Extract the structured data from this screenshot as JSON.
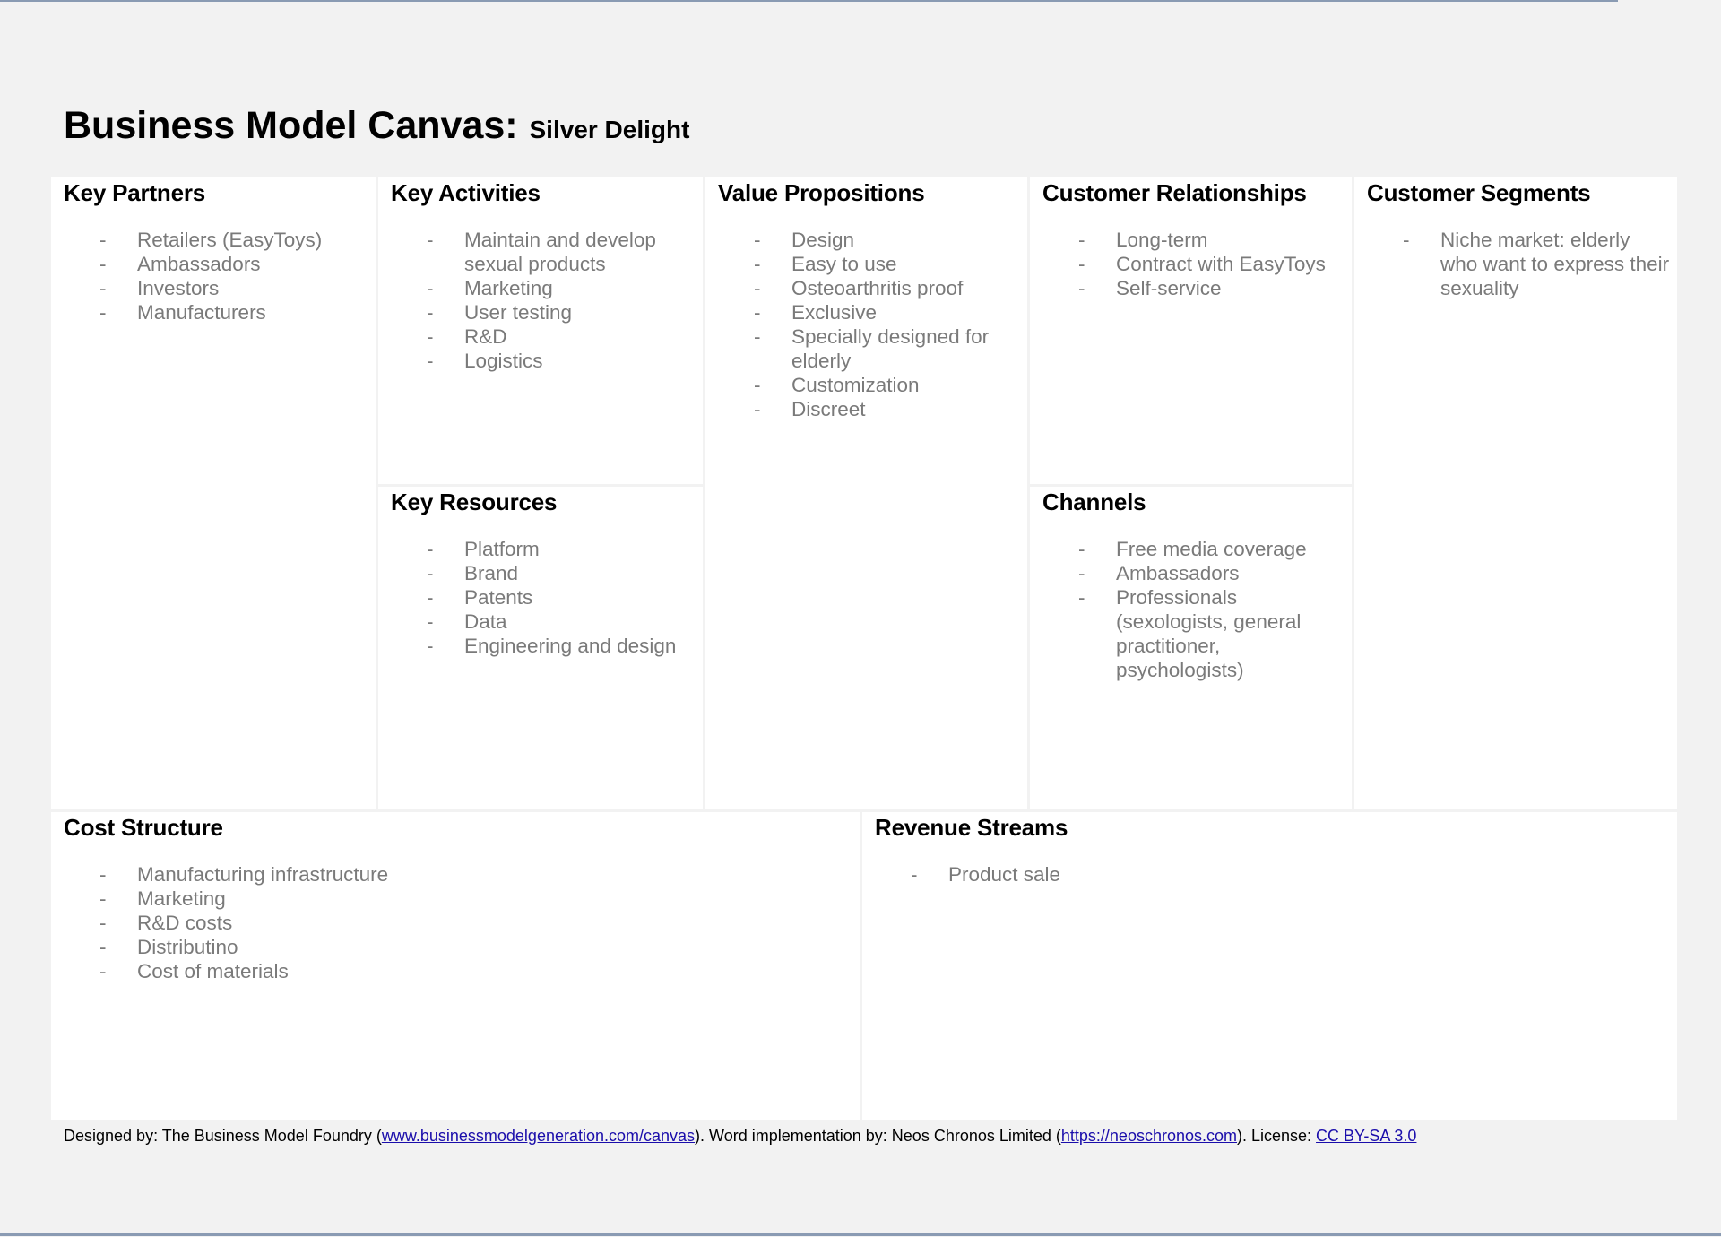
{
  "title": {
    "main": "Business Model Canvas:",
    "sub": "Silver Delight"
  },
  "canvas": {
    "key_partners": {
      "heading": "Key Partners",
      "items": [
        "Retailers (EasyToys)",
        "Ambassadors",
        "Investors",
        "Manufacturers"
      ]
    },
    "key_activities": {
      "heading": "Key Activities",
      "items": [
        "Maintain and develop sexual products",
        "Marketing",
        "User testing",
        "R&D",
        "Logistics"
      ]
    },
    "key_resources": {
      "heading": "Key Resources",
      "items": [
        "Platform",
        "Brand",
        "Patents",
        "Data",
        "Engineering and design"
      ]
    },
    "value_propositions": {
      "heading": "Value Propositions",
      "items": [
        "Design",
        "Easy to use",
        "Osteoarthritis proof",
        "Exclusive",
        "Specially designed for elderly",
        "Customization",
        "Discreet"
      ]
    },
    "customer_relationships": {
      "heading": "Customer Relationships",
      "items": [
        "Long-term",
        "Contract with EasyToys",
        "Self-service"
      ]
    },
    "channels": {
      "heading": "Channels",
      "items": [
        "Free media coverage",
        "Ambassadors",
        "Professionals (sexologists, general practitioner, psychologists)"
      ]
    },
    "customer_segments": {
      "heading": "Customer Segments",
      "items": [
        "Niche market: elderly who want to express their sexuality"
      ]
    },
    "cost_structure": {
      "heading": "Cost Structure",
      "items": [
        "Manufacturing infrastructure",
        "Marketing",
        "R&D costs",
        "Distributino",
        "Cost of materials"
      ]
    },
    "revenue_streams": {
      "heading": "Revenue Streams",
      "items": [
        "Product sale"
      ]
    },
    "bullet": "-"
  },
  "footer": {
    "part1": "Designed by: The Business Model Foundry (",
    "link1": "www.businessmodelgeneration.com/canvas",
    "part2": "). Word implementation by: Neos Chronos Limited (",
    "link2": "https://neoschronos.com",
    "part3": "). License: ",
    "link3": "CC BY-SA 3.0"
  },
  "colors": {
    "background": "#f2f2f2",
    "block": "#ffffff",
    "item_text": "#7a7a7a",
    "link": "#1a0dab"
  }
}
